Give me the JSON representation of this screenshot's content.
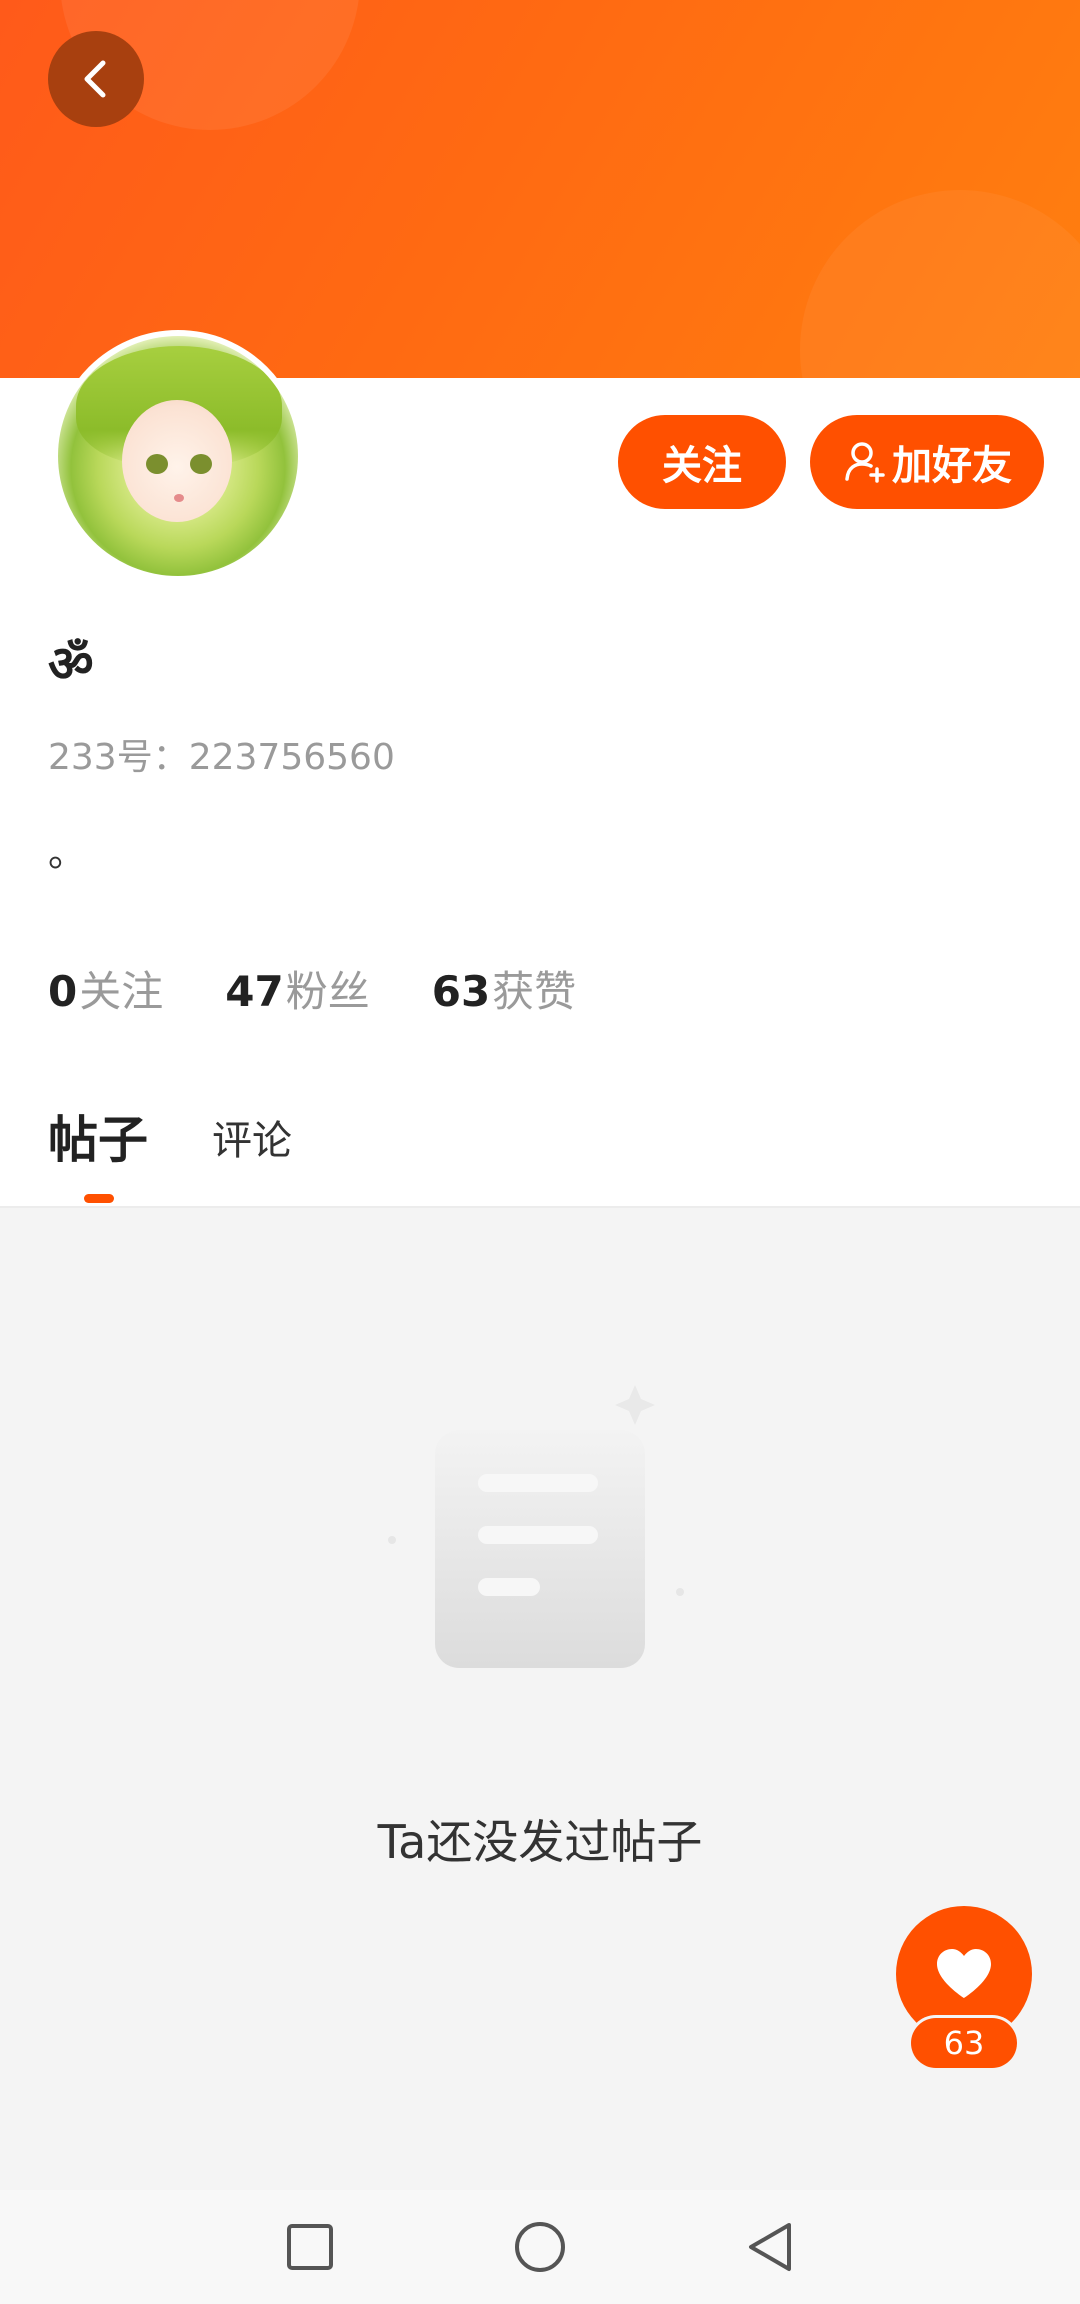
{
  "colors": {
    "accent": "#ff5000",
    "header_start": "#ff5a1a",
    "header_end": "#ff7f0f"
  },
  "header": {
    "back_icon": "chevron-left-icon"
  },
  "profile": {
    "username": "ॐ",
    "uid_text": "233号：223756560",
    "bio": "。",
    "follow_label": "关注",
    "add_friend_label": "加好友"
  },
  "stats": [
    {
      "num": "0",
      "label": "关注"
    },
    {
      "num": "47",
      "label": "粉丝"
    },
    {
      "num": "63",
      "label": "获赞"
    }
  ],
  "tabs": {
    "posts": "帖子",
    "comments": "评论",
    "active": "posts"
  },
  "empty": {
    "text": "Ta还没发过帖子",
    "icon": "document-icon"
  },
  "like_fab": {
    "icon": "heart-icon",
    "count": "63"
  },
  "navbar": {
    "icons": [
      "square-icon",
      "circle-icon",
      "triangle-back-icon"
    ]
  }
}
